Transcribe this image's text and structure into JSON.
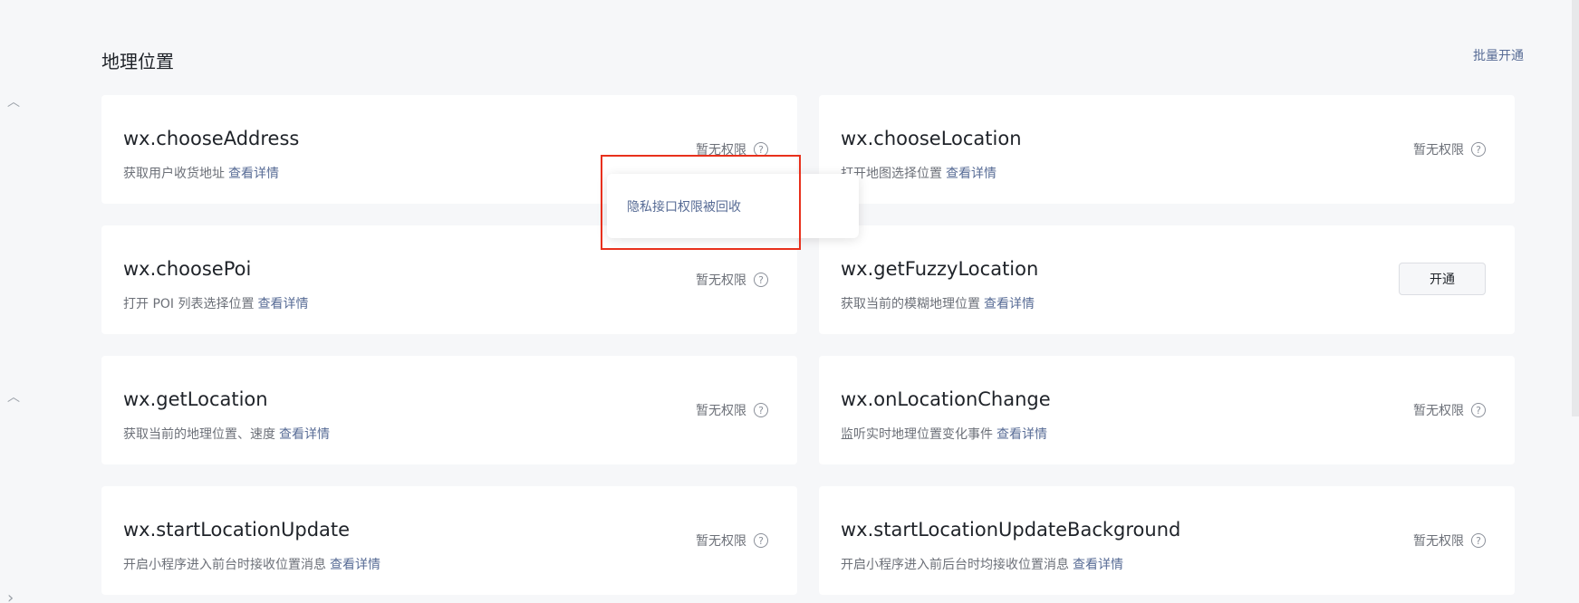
{
  "section": {
    "title": "地理位置",
    "batch_open_label": "批量开通"
  },
  "cards": [
    {
      "title": "wx.chooseAddress",
      "desc": "获取用户收货地址",
      "link": "查看详情",
      "status": "暂无权限"
    },
    {
      "title": "wx.chooseLocation",
      "desc": "打开地图选择位置",
      "link": "查看详情",
      "status": "暂无权限"
    },
    {
      "title": "wx.choosePoi",
      "desc": "打开 POI 列表选择位置",
      "link": "查看详情",
      "status": "暂无权限"
    },
    {
      "title": "wx.getFuzzyLocation",
      "desc": "获取当前的模糊地理位置",
      "link": "查看详情",
      "button": "开通"
    },
    {
      "title": "wx.getLocation",
      "desc": "获取当前的地理位置、速度",
      "link": "查看详情",
      "status": "暂无权限"
    },
    {
      "title": "wx.onLocationChange",
      "desc": "监听实时地理位置变化事件",
      "link": "查看详情",
      "status": "暂无权限"
    },
    {
      "title": "wx.startLocationUpdate",
      "desc": "开启小程序进入前台时接收位置消息",
      "link": "查看详情",
      "status": "暂无权限"
    },
    {
      "title": "wx.startLocationUpdateBackground",
      "desc": "开启小程序进入前后台时均接收位置消息",
      "link": "查看详情",
      "status": "暂无权限"
    }
  ],
  "tooltip": {
    "text": "隐私接口权限被回收"
  },
  "icons": {
    "help": "?",
    "chevron_up": "︿",
    "chevron_right": "›"
  },
  "colors": {
    "link": "#576b95",
    "highlight": "#e8301c"
  }
}
